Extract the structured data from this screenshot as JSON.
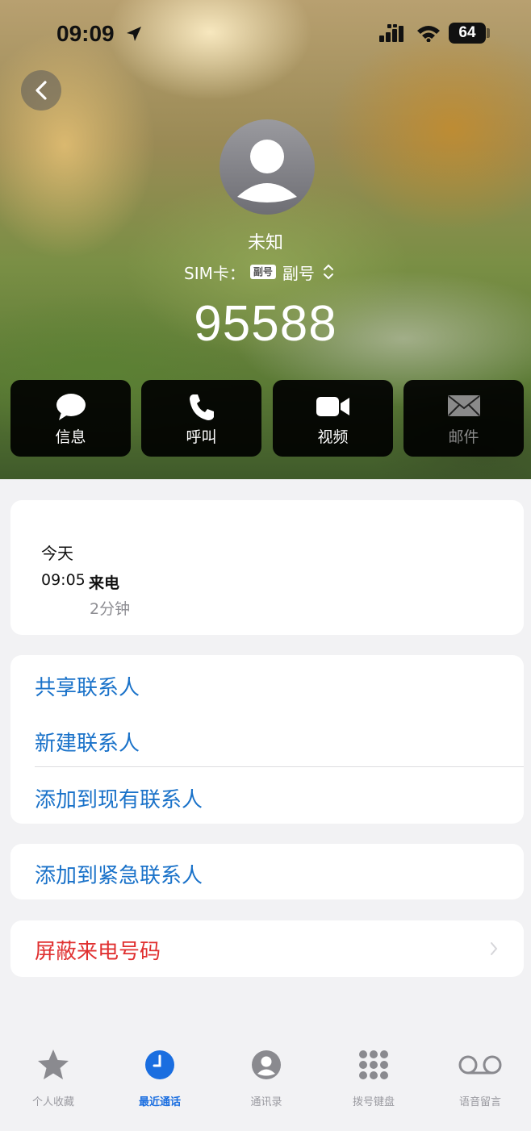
{
  "status_bar": {
    "time": "09:09",
    "battery": "64"
  },
  "contact": {
    "name": "未知",
    "sim_label": "SIM卡：",
    "sim_badge": "副号",
    "sim_value": "副号",
    "number": "95588"
  },
  "actions": [
    {
      "label": "信息",
      "icon": "message-bubble-icon"
    },
    {
      "label": "呼叫",
      "icon": "phone-icon"
    },
    {
      "label": "视频",
      "icon": "video-camera-icon"
    },
    {
      "label": "邮件",
      "icon": "mail-icon"
    }
  ],
  "history": {
    "day": "今天",
    "time": "09:05",
    "type": "来电",
    "duration": "2分钟"
  },
  "contact_actions": {
    "share": "共享联系人",
    "new": "新建联系人",
    "add_existing": "添加到现有联系人",
    "add_emergency": "添加到紧急联系人",
    "block": "屏蔽来电号码"
  },
  "tabs": [
    {
      "label": "个人收藏",
      "icon": "star-icon"
    },
    {
      "label": "最近通话",
      "icon": "clock-icon",
      "active": true
    },
    {
      "label": "通讯录",
      "icon": "contact-icon"
    },
    {
      "label": "拨号键盘",
      "icon": "keypad-icon"
    },
    {
      "label": "语音留言",
      "icon": "voicemail-icon"
    }
  ],
  "colors": {
    "link_blue": "#1a72c9",
    "danger_red": "#e03030",
    "tab_active": "#1a6ee0"
  }
}
